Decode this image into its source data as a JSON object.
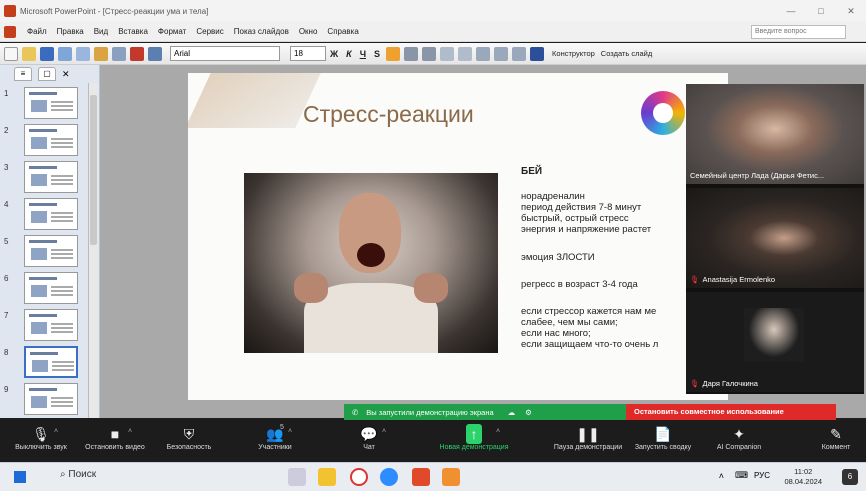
{
  "window": {
    "title": "Microsoft PowerPoint - [Стресс-реакции ума и тела]",
    "controls": [
      "—",
      "□",
      "✕"
    ]
  },
  "menu": {
    "items": [
      "Файл",
      "Правка",
      "Вид",
      "Вставка",
      "Формат",
      "Сервис",
      "Показ слайдов",
      "Окно",
      "Справка"
    ],
    "ask_placeholder": "Введите вопрос"
  },
  "toolbar": {
    "font": "Arial",
    "size": "18",
    "format_buttons": [
      "Ж",
      "К",
      "Ч",
      "S"
    ],
    "designer": "Конструктор",
    "new_slide": "Создать слайд"
  },
  "slides_pane": {
    "tabs": [
      "≡",
      "▢"
    ],
    "slide_numbers": [
      "1",
      "2",
      "3",
      "4",
      "5",
      "6",
      "7",
      "8",
      "9"
    ],
    "selected": "8"
  },
  "slide": {
    "title": "Стресс-реакции",
    "heading": "БЕЙ",
    "lines": [
      "норадреналин",
      "период действия 7-8 минут",
      "быстрый, острый стресс",
      "энергия и напряжение растет",
      "эмоция ЗЛОСТИ",
      "регресс в возраст 3-4 года",
      "если стрессор кажется нам ме",
      "слабее, чем мы сами;",
      "если нас много;",
      "если защищаем что-то очень л"
    ]
  },
  "participants": [
    {
      "name": "Семейный центр Лада (Дарья Фетис...",
      "muted": false
    },
    {
      "name": "Anastasija Ermolenko",
      "muted": true
    },
    {
      "name": "Даря Галочкина",
      "muted": true
    }
  ],
  "share_banner": {
    "text": "Вы запустили демонстрацию экрана",
    "stop": "Остановить совместное использование"
  },
  "zoom_controls": [
    {
      "icon": "🎙",
      "label": "Выключить звук"
    },
    {
      "icon": "■",
      "label": "Остановить видео"
    },
    {
      "icon": "⛨",
      "label": "Безопасность"
    },
    {
      "icon": "👥",
      "label": "Участники",
      "badge": "5"
    },
    {
      "icon": "💬",
      "label": "Чат"
    },
    {
      "icon": "↑",
      "label": "Новая демонстрация"
    },
    {
      "icon": "❚❚",
      "label": "Пауза демонстрации"
    },
    {
      "icon": "📄",
      "label": "Запустить сводку"
    },
    {
      "icon": "✦",
      "label": "AI Companion"
    },
    {
      "icon": "✎",
      "label": "Коммент"
    }
  ],
  "taskbar": {
    "search": "Поиск",
    "lang": "РУС",
    "time": "11:02",
    "date": "08.04.2024",
    "notifications": "6"
  },
  "colors": {
    "share_green": "#1f9f4a",
    "stop_red": "#e02a2a",
    "title_brown": "#8a6a4a"
  }
}
